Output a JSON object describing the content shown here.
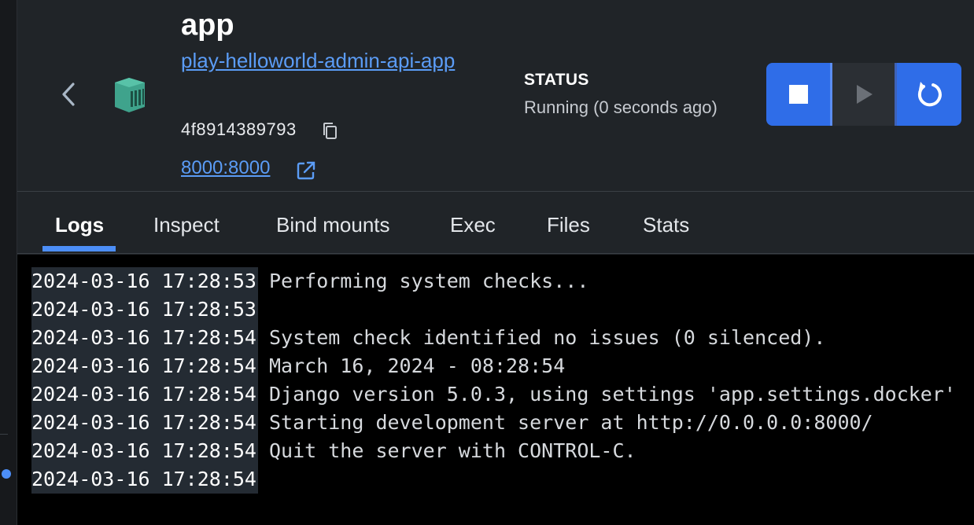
{
  "container": {
    "title": "app",
    "image_link": "play-helloworld-admin-api-app",
    "id": "4f8914389793",
    "ports": "8000:8000"
  },
  "status": {
    "label": "STATUS",
    "value": "Running (0 seconds ago)"
  },
  "controls": {
    "stop_icon": "stop-icon",
    "play_icon": "play-icon",
    "restart_icon": "restart-icon"
  },
  "tabs": [
    {
      "label": "Logs",
      "active": true
    },
    {
      "label": "Inspect",
      "active": false
    },
    {
      "label": "Bind mounts",
      "active": false
    },
    {
      "label": "Exec",
      "active": false
    },
    {
      "label": "Files",
      "active": false
    },
    {
      "label": "Stats",
      "active": false
    }
  ],
  "logs": [
    {
      "timestamp": "2024-03-16 17:28:53",
      "message": "Performing system checks..."
    },
    {
      "timestamp": "2024-03-16 17:28:53",
      "message": ""
    },
    {
      "timestamp": "2024-03-16 17:28:54",
      "message": "System check identified no issues (0 silenced)."
    },
    {
      "timestamp": "2024-03-16 17:28:54",
      "message": "March 16, 2024 - 08:28:54"
    },
    {
      "timestamp": "2024-03-16 17:28:54",
      "message": "Django version 5.0.3, using settings 'app.settings.docker'"
    },
    {
      "timestamp": "2024-03-16 17:28:54",
      "message": "Starting development server at http://0.0.0.0:8000/"
    },
    {
      "timestamp": "2024-03-16 17:28:54",
      "message": "Quit the server with CONTROL-C."
    },
    {
      "timestamp": "2024-03-16 17:28:54",
      "message": ""
    }
  ],
  "colors": {
    "accent": "#2f6de8",
    "link": "#5b9cf6",
    "container_icon": "#3fa38c"
  }
}
